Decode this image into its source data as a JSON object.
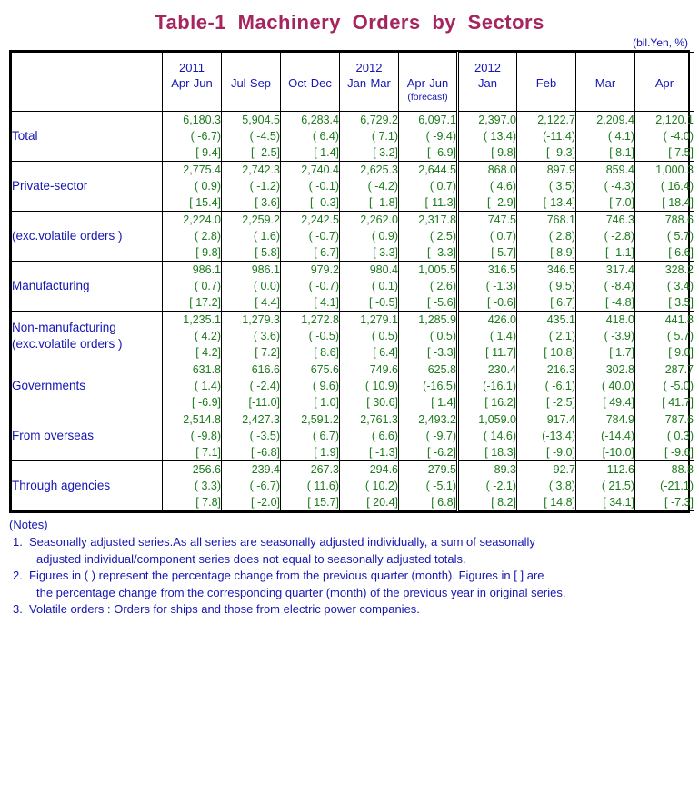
{
  "title": "Table-1  Machinery  Orders  by  Sectors",
  "unit_note": "(bil.Yen, %)",
  "colors": {
    "title": "#a5255f",
    "label_text": "#1616b4",
    "number_text": "#1a7a1a",
    "border": "#000000"
  },
  "header": {
    "corner": "",
    "columns": [
      {
        "year": "2011",
        "period": "Apr-Jun",
        "sub": ""
      },
      {
        "year": "",
        "period": "Jul-Sep",
        "sub": ""
      },
      {
        "year": "",
        "period": "Oct-Dec",
        "sub": ""
      },
      {
        "year": "2012",
        "period": "Jan-Mar",
        "sub": ""
      },
      {
        "year": "",
        "period": "Apr-Jun",
        "sub": "(forecast)"
      },
      {
        "year": "2012",
        "period": "Jan",
        "sub": ""
      },
      {
        "year": "",
        "period": "Feb",
        "sub": ""
      },
      {
        "year": "",
        "period": "Mar",
        "sub": ""
      },
      {
        "year": "",
        "period": "Apr",
        "sub": ""
      }
    ]
  },
  "rows": [
    {
      "label": "Total",
      "label2": "",
      "indent": 0,
      "level": [
        "6,180.3",
        "5,904.5",
        "6,283.4",
        "6,729.2",
        "6,097.1",
        "2,397.0",
        "2,122.7",
        "2,209.4",
        "2,120.1"
      ],
      "qoq": [
        "( -6.7)",
        "( -4.5)",
        "(  6.4)",
        "(  7.1)",
        "( -9.4)",
        "( 13.4)",
        "(-11.4)",
        "(  4.1)",
        "( -4.0)"
      ],
      "yoy": [
        "[  9.4]",
        "[ -2.5]",
        "[  1.4]",
        "[  3.2]",
        "[ -6.9]",
        "[  9.8]",
        "[ -9.3]",
        "[  8.1]",
        "[  7.5]"
      ]
    },
    {
      "label": "Private-sector",
      "label2": "",
      "indent": 1,
      "level": [
        "2,775.4",
        "2,742.3",
        "2,740.4",
        "2,625.3",
        "2,644.5",
        "868.0",
        "897.9",
        "859.4",
        "1,000.3"
      ],
      "qoq": [
        "(  0.9)",
        "( -1.2)",
        "( -0.1)",
        "( -4.2)",
        "(  0.7)",
        "(  4.6)",
        "(  3.5)",
        "( -4.3)",
        "( 16.4)"
      ],
      "yoy": [
        "[ 15.4]",
        "[  3.6]",
        "[ -0.3]",
        "[ -1.8]",
        "[-11.3]",
        "[ -2.9]",
        "[-13.4]",
        "[  7.0]",
        "[ 18.4]"
      ]
    },
    {
      "label": "(exc.volatile orders )",
      "label2": "",
      "indent": 1,
      "level": [
        "2,224.0",
        "2,259.2",
        "2,242.5",
        "2,262.0",
        "2,317.8",
        "747.5",
        "768.1",
        "746.3",
        "788.6"
      ],
      "qoq": [
        "(  2.8)",
        "(  1.6)",
        "( -0.7)",
        "(  0.9)",
        "(  2.5)",
        "(  0.7)",
        "(  2.8)",
        "( -2.8)",
        "(  5.7)"
      ],
      "yoy": [
        "[  9.8]",
        "[  5.8]",
        "[  6.7]",
        "[  3.3]",
        "[ -3.3]",
        "[  5.7]",
        "[  8.9]",
        "[ -1.1]",
        "[  6.6]"
      ]
    },
    {
      "label": "Manufacturing",
      "label2": "",
      "indent": 2,
      "level": [
        "986.1",
        "986.1",
        "979.2",
        "980.4",
        "1,005.5",
        "316.5",
        "346.5",
        "317.4",
        "328.2"
      ],
      "qoq": [
        "(  0.7)",
        "(  0.0)",
        "( -0.7)",
        "(  0.1)",
        "(  2.6)",
        "( -1.3)",
        "(  9.5)",
        "( -8.4)",
        "(  3.4)"
      ],
      "yoy": [
        "[ 17.2]",
        "[  4.4]",
        "[  4.1]",
        "[ -0.5]",
        "[ -5.6]",
        "[ -0.6]",
        "[  6.7]",
        "[ -4.8]",
        "[  3.5]"
      ]
    },
    {
      "label": "Non-manufacturing",
      "label2": "(exc.volatile orders )",
      "indent": 2,
      "level": [
        "1,235.1",
        "1,279.3",
        "1,272.8",
        "1,279.1",
        "1,285.9",
        "426.0",
        "435.1",
        "418.0",
        "441.8"
      ],
      "qoq": [
        "(  4.2)",
        "(  3.6)",
        "( -0.5)",
        "(  0.5)",
        "(  0.5)",
        "(  1.4)",
        "(  2.1)",
        "( -3.9)",
        "(  5.7)"
      ],
      "yoy": [
        "[  4.2]",
        "[  7.2]",
        "[  8.6]",
        "[  6.4]",
        "[ -3.3]",
        "[ 11.7]",
        "[ 10.8]",
        "[  1.7]",
        "[  9.0]"
      ]
    },
    {
      "label": "Governments",
      "label2": "",
      "indent": 1,
      "level": [
        "631.8",
        "616.6",
        "675.6",
        "749.6",
        "625.8",
        "230.4",
        "216.3",
        "302.8",
        "287.7"
      ],
      "qoq": [
        "(  1.4)",
        "( -2.4)",
        "(  9.6)",
        "( 10.9)",
        "(-16.5)",
        "(-16.1)",
        "( -6.1)",
        "( 40.0)",
        "( -5.0)"
      ],
      "yoy": [
        "[ -6.9]",
        "[-11.0]",
        "[  1.0]",
        "[ 30.6]",
        "[  1.4]",
        "[ 16.2]",
        "[ -2.5]",
        "[ 49.4]",
        "[ 41.7]"
      ]
    },
    {
      "label": "From overseas",
      "label2": "",
      "indent": 1,
      "level": [
        "2,514.8",
        "2,427.3",
        "2,591.2",
        "2,761.3",
        "2,493.2",
        "1,059.0",
        "917.4",
        "784.9",
        "787.6"
      ],
      "qoq": [
        "( -9.8)",
        "( -3.5)",
        "(  6.7)",
        "(  6.6)",
        "( -9.7)",
        "( 14.6)",
        "(-13.4)",
        "(-14.4)",
        "(  0.3)"
      ],
      "yoy": [
        "[  7.1]",
        "[ -6.8]",
        "[  1.9]",
        "[ -1.3]",
        "[ -6.2]",
        "[ 18.3]",
        "[ -9.0]",
        "[-10.0]",
        "[ -9.6]"
      ]
    },
    {
      "label": "Through agencies",
      "label2": "",
      "indent": 1,
      "level": [
        "256.6",
        "239.4",
        "267.3",
        "294.6",
        "279.5",
        "89.3",
        "92.7",
        "112.6",
        "88.8"
      ],
      "qoq": [
        "(  3.3)",
        "( -6.7)",
        "( 11.6)",
        "( 10.2)",
        "( -5.1)",
        "( -2.1)",
        "(  3.8)",
        "( 21.5)",
        "(-21.1)"
      ],
      "yoy": [
        "[  7.8]",
        "[ -2.0]",
        "[ 15.7]",
        "[ 20.4]",
        "[  6.8]",
        "[  8.2]",
        "[ 14.8]",
        "[ 34.1]",
        "[ -7.3]"
      ]
    }
  ],
  "notes": {
    "heading": "(Notes)",
    "items": [
      {
        "mark": "1.",
        "line1": "Seasonally adjusted series.As all series are seasonally adjusted individually, a sum of seasonally",
        "line2": "adjusted individual/component series does not equal to seasonally adjusted totals."
      },
      {
        "mark": "2.",
        "line1": "Figures in ( ) represent the percentage change from the previous quarter (month). Figures in [ ] are",
        "line2": "the percentage change from the corresponding quarter (month) of the previous year in original series."
      },
      {
        "mark": "3.",
        "line1": "Volatile orders : Orders for ships and those from electric power companies.",
        "line2": ""
      }
    ]
  }
}
